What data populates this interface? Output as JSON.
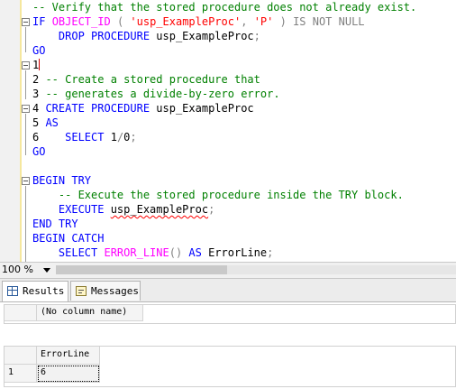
{
  "editor": {
    "lines": [
      {
        "parts": [
          [
            "cm",
            "-- Verify that the stored procedure does not already exist."
          ]
        ]
      },
      {
        "parts": [
          [
            "kw",
            "IF "
          ],
          [
            "fn",
            "OBJECT_ID"
          ],
          [
            "gray",
            " ( "
          ],
          [
            "str",
            "'usp_ExampleProc'"
          ],
          [
            "gray",
            ", "
          ],
          [
            "str",
            "'P'"
          ],
          [
            "gray",
            " ) "
          ],
          [
            "gray",
            "IS NOT NULL"
          ]
        ]
      },
      {
        "parts": [
          [
            "kw",
            "    DROP PROCEDURE "
          ],
          [
            "ln",
            "usp_ExampleProc"
          ],
          [
            "gray",
            ";"
          ]
        ]
      },
      {
        "parts": [
          [
            "kw",
            "GO"
          ]
        ]
      },
      {
        "parts": [
          [
            "ln",
            "1"
          ]
        ]
      },
      {
        "parts": [
          [
            "ln",
            "2 "
          ],
          [
            "cm",
            "-- Create a stored procedure that"
          ]
        ]
      },
      {
        "parts": [
          [
            "ln",
            "3 "
          ],
          [
            "cm",
            "-- generates a divide-by-zero error."
          ]
        ]
      },
      {
        "parts": [
          [
            "ln",
            "4 "
          ],
          [
            "kw",
            "CREATE PROCEDURE "
          ],
          [
            "ln",
            "usp_ExampleProc"
          ]
        ]
      },
      {
        "parts": [
          [
            "ln",
            "5 "
          ],
          [
            "kw",
            "AS"
          ]
        ]
      },
      {
        "parts": [
          [
            "ln",
            "6    "
          ],
          [
            "kw",
            "SELECT "
          ],
          [
            "ln",
            "1"
          ],
          [
            "gray",
            "/"
          ],
          [
            "ln",
            "0"
          ],
          [
            "gray",
            ";"
          ]
        ]
      },
      {
        "parts": [
          [
            "kw",
            "GO"
          ]
        ]
      },
      {
        "parts": [
          [
            "ln",
            ""
          ]
        ]
      },
      {
        "parts": [
          [
            "kw",
            "BEGIN TRY"
          ]
        ]
      },
      {
        "parts": [
          [
            "cm",
            "    -- Execute the stored procedure inside the TRY block."
          ]
        ]
      },
      {
        "parts": [
          [
            "kw",
            "    EXECUTE "
          ],
          [
            "sq",
            "usp_ExampleProc"
          ],
          [
            "gray",
            ";"
          ]
        ]
      },
      {
        "parts": [
          [
            "kw",
            "END TRY"
          ]
        ]
      },
      {
        "parts": [
          [
            "kw",
            "BEGIN CATCH"
          ]
        ]
      },
      {
        "parts": [
          [
            "kw",
            "    SELECT "
          ],
          [
            "fn",
            "ERROR_LINE"
          ],
          [
            "gray",
            "() "
          ],
          [
            "kw",
            "AS "
          ],
          [
            "ln",
            "ErrorLine"
          ],
          [
            "gray",
            ";"
          ]
        ]
      }
    ]
  },
  "status": {
    "zoom": "100 %"
  },
  "tabs": {
    "results": "Results",
    "messages": "Messages"
  },
  "grid1": {
    "header": "(No column name)"
  },
  "grid2": {
    "header": "ErrorLine",
    "row_number": "1",
    "value": "6"
  },
  "colors": {
    "keyword": "#0000ff",
    "comment": "#008000",
    "string": "#ff0000",
    "function": "#ff00ff",
    "gray": "#808080"
  }
}
